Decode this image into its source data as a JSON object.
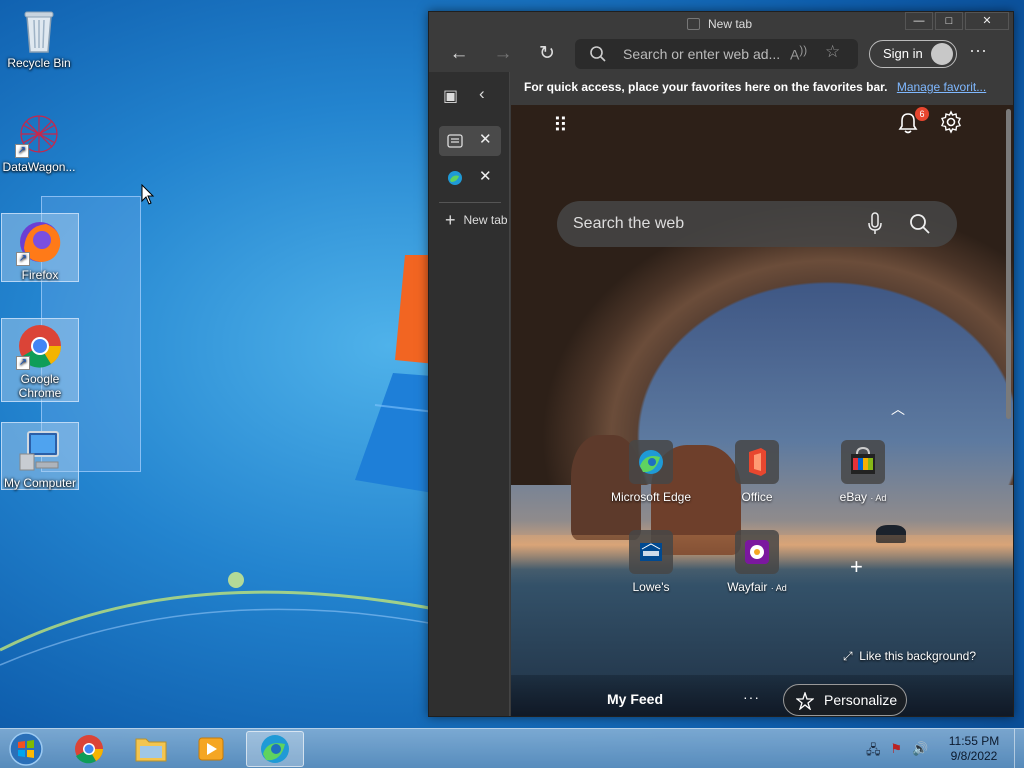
{
  "desktop": {
    "icons": [
      {
        "label": "Recycle Bin"
      },
      {
        "label": "DataWagon..."
      },
      {
        "label": "Firefox"
      },
      {
        "label": "Google Chrome"
      },
      {
        "label": "My Computer"
      }
    ]
  },
  "browser": {
    "window_title": "New tab",
    "address_placeholder": "Search or enter web ad...",
    "sign_in_label": "Sign in",
    "favorites_bar_text": "For quick access, place your favorites here on the favorites bar.",
    "favorites_bar_link": "Manage favorit...",
    "vertical_tabs": {
      "new_tab_label": "New tab"
    },
    "new_tab_page": {
      "notification_count": "6",
      "search_placeholder": "Search the web",
      "quick_links": [
        {
          "label": "Microsoft Edge",
          "ad": ""
        },
        {
          "label": "Office",
          "ad": ""
        },
        {
          "label": "eBay",
          "ad": "· Ad"
        },
        {
          "label": "Lowe's",
          "ad": ""
        },
        {
          "label": "Wayfair",
          "ad": "· Ad"
        }
      ],
      "like_background": "Like this background?",
      "my_feed": "My Feed",
      "feed_more": "···",
      "personalize": "Personalize"
    }
  },
  "taskbar": {
    "time": "11:55 PM",
    "date": "9/8/2022"
  },
  "colors": {
    "accent_blue": "#1a73e8",
    "browser_bg": "#3b3b3b",
    "notification_badge": "#e8462f"
  }
}
